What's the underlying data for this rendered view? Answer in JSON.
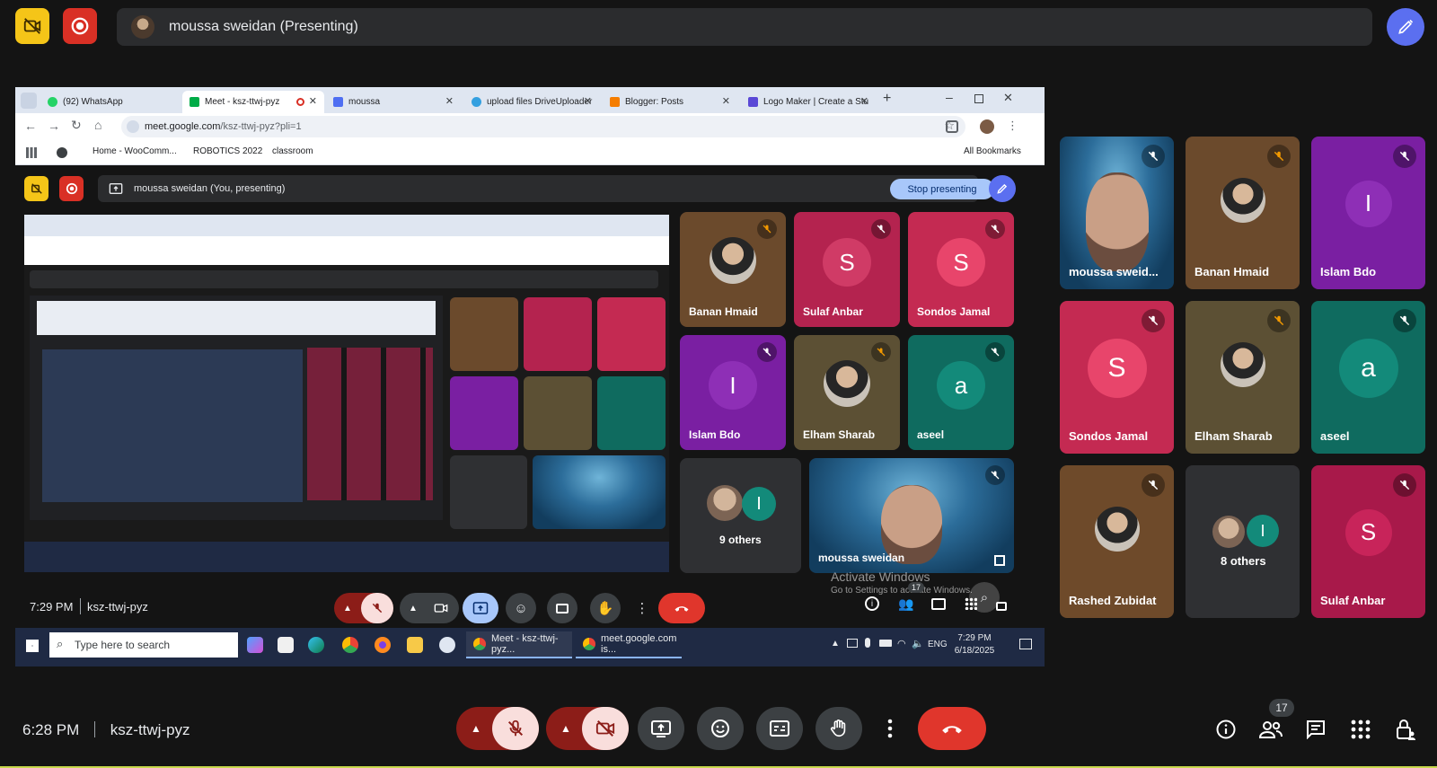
{
  "topbar": {
    "presenter_title": "moussa sweidan (Presenting)"
  },
  "browser": {
    "tabs": [
      {
        "label": "(92) WhatsApp",
        "icon": "whatsapp-icon"
      },
      {
        "label": "Meet - ksz-ttwj-pyz",
        "icon": "meet-icon"
      },
      {
        "label": "moussa",
        "icon": "window-icon"
      },
      {
        "label": "upload files DriveUploader",
        "icon": "upload-icon"
      },
      {
        "label": "Blogger: Posts",
        "icon": "blogger-icon"
      },
      {
        "label": "Logo Maker | Create a Stu",
        "icon": "logo-icon"
      }
    ],
    "url_host": "meet.google.com",
    "url_path": "/ksz-ttwj-pyz?pli=1",
    "bookmarks": [
      "Home - WooComm...",
      "ROBOTICS 2022",
      "classroom"
    ],
    "all_bookmarks": "All Bookmarks"
  },
  "inner_meet": {
    "presenting_title": "moussa sweidan (You, presenting)",
    "stop_presenting": "Stop presenting",
    "tiles": [
      {
        "name": "Banan Hmaid"
      },
      {
        "name": "Sulaf Anbar",
        "letter": "S"
      },
      {
        "name": "Sondos Jamal",
        "letter": "S"
      },
      {
        "name": "Islam Bdo",
        "letter": "I"
      },
      {
        "name": "Elham Sharab"
      },
      {
        "name": "aseel",
        "letter": "a"
      },
      {
        "name": "9 others",
        "letter": "I"
      },
      {
        "name": "moussa sweidan"
      }
    ],
    "watermark_title": "Activate Windows",
    "watermark_sub": "Go to Settings to activate Windows.",
    "time": "7:29 PM",
    "meeting_code": "ksz-ttwj-pyz",
    "people_count": "17"
  },
  "taskbar": {
    "search_placeholder": "Type here to search",
    "task1": "Meet - ksz-ttwj-pyz...",
    "task2": "meet.google.com is...",
    "lang": "ENG",
    "clock_time": "7:29 PM",
    "clock_date": "6/18/2025"
  },
  "grid": [
    {
      "name": "moussa sweid...",
      "kind": "video"
    },
    {
      "name": "Banan Hmaid",
      "kind": "photo"
    },
    {
      "name": "Islam Bdo",
      "letter": "I"
    },
    {
      "name": "Sondos Jamal",
      "letter": "S"
    },
    {
      "name": "Elham Sharab",
      "kind": "photo"
    },
    {
      "name": "aseel",
      "letter": "a"
    },
    {
      "name": "Rashed Zubidat",
      "kind": "photo"
    },
    {
      "name": "8 others",
      "letter": "I"
    },
    {
      "name": "Sulaf Anbar",
      "letter": "S"
    }
  ],
  "bottombar": {
    "time": "6:28 PM",
    "meeting_code": "ksz-ttwj-pyz",
    "people_badge": "17"
  },
  "colors": {
    "end_call": "#e0362c",
    "muted_bg": "#f9dedc",
    "muted_dark": "#8c1d18",
    "accent_blue": "#a8c7fa"
  }
}
